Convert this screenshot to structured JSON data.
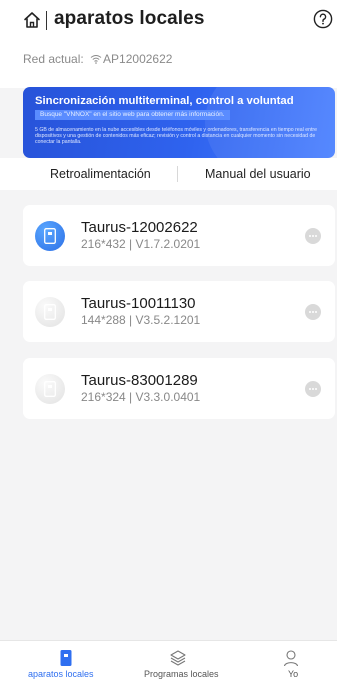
{
  "header": {
    "title": "aparatos locales",
    "network_label": "Red actual:",
    "network_name": "AP12002622"
  },
  "banner": {
    "title": "Sincronización multiterminal, control a voluntad",
    "tag": "Busque \"VNNOX\" en el sitio web para obtener más información.",
    "description": "5 GB de almacenamiento en la nube accesibles desde teléfonos móviles y ordenadores, transferencia en tiempo real entre dispositivos y una gestión de contenidos más eficaz; revisión y control a distancia en cualquier momento sin necesidad de conectar la pantalla."
  },
  "links": {
    "feedback": "Retroalimentación",
    "manual": "Manual del usuario"
  },
  "devices": [
    {
      "name": "Taurus-12002622",
      "meta": "216*432 | V1.7.2.0201",
      "active": true
    },
    {
      "name": "Taurus-10011130",
      "meta": "144*288 | V3.5.2.1201",
      "active": false
    },
    {
      "name": "Taurus-83001289",
      "meta": "216*324 | V3.3.0.0401",
      "active": false
    }
  ],
  "tabbar": {
    "tabs": [
      {
        "label": "aparatos locales",
        "icon": "device-icon",
        "active": true
      },
      {
        "label": "Programas locales",
        "icon": "layers-icon",
        "active": false
      },
      {
        "label": "Yo",
        "icon": "user-icon",
        "active": false
      }
    ]
  },
  "colors": {
    "accent": "#2f6ff0",
    "banner": "#2f63ef",
    "background": "#f4f4f5"
  }
}
